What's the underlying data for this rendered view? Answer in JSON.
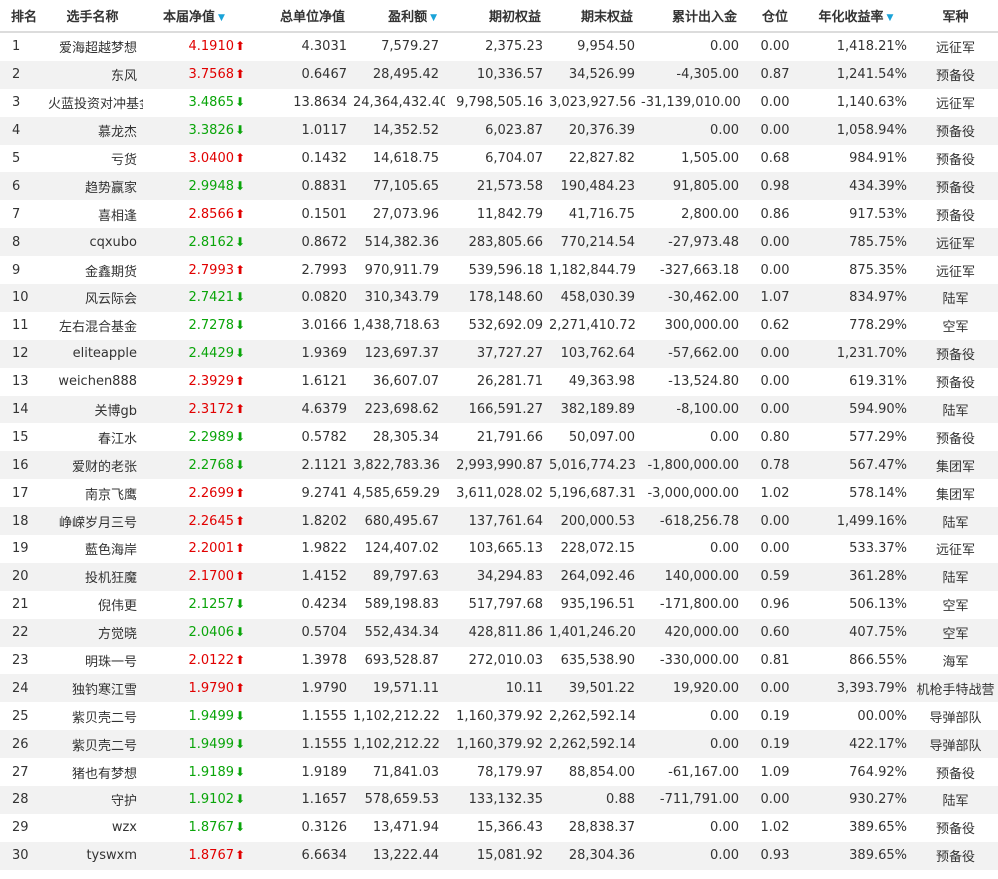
{
  "headers": {
    "rank": "排名",
    "name": "选手名称",
    "nav": "本届净值",
    "total_nav": "总单位净值",
    "profit": "盈利额",
    "start_equity": "期初权益",
    "end_equity": "期末权益",
    "cash_flow": "累计出入金",
    "position": "仓位",
    "annual": "年化收益率",
    "army": "军种"
  },
  "sort_icon": "▼",
  "colors": {
    "up": "#e10000",
    "down": "#0aa50a",
    "sort": "#1aa3d8",
    "stripe": "#f2f2f2"
  },
  "rows": [
    {
      "rank": "1",
      "name": "爱海超越梦想",
      "nav": "4.1910",
      "dir": "up",
      "total_nav": "4.3031",
      "profit": "7,579.27",
      "start": "2,375.23",
      "end": "9,954.50",
      "cash": "0.00",
      "pos": "0.00",
      "annual": "1,418.21%",
      "army": "远征军"
    },
    {
      "rank": "2",
      "name": "东风",
      "nav": "3.7568",
      "dir": "up",
      "total_nav": "0.6467",
      "profit": "28,495.42",
      "start": "10,336.57",
      "end": "34,526.99",
      "cash": "-4,305.00",
      "pos": "0.87",
      "annual": "1,241.54%",
      "army": "预备役"
    },
    {
      "rank": "3",
      "name": "火蓝投资对冲基金",
      "nav": "3.4865",
      "dir": "down",
      "total_nav": "13.8634",
      "profit": "24,364,432.40",
      "start": "9,798,505.16",
      "end": "3,023,927.56",
      "cash": "-31,139,010.00",
      "pos": "0.00",
      "annual": "1,140.63%",
      "army": "远征军"
    },
    {
      "rank": "4",
      "name": "慕龙杰",
      "nav": "3.3826",
      "dir": "down",
      "total_nav": "1.0117",
      "profit": "14,352.52",
      "start": "6,023.87",
      "end": "20,376.39",
      "cash": "0.00",
      "pos": "0.00",
      "annual": "1,058.94%",
      "army": "预备役"
    },
    {
      "rank": "5",
      "name": "亏货",
      "nav": "3.0400",
      "dir": "up",
      "total_nav": "0.1432",
      "profit": "14,618.75",
      "start": "6,704.07",
      "end": "22,827.82",
      "cash": "1,505.00",
      "pos": "0.68",
      "annual": "984.91%",
      "army": "预备役"
    },
    {
      "rank": "6",
      "name": "趋势赢家",
      "nav": "2.9948",
      "dir": "down",
      "total_nav": "0.8831",
      "profit": "77,105.65",
      "start": "21,573.58",
      "end": "190,484.23",
      "cash": "91,805.00",
      "pos": "0.98",
      "annual": "434.39%",
      "army": "预备役"
    },
    {
      "rank": "7",
      "name": "喜相逢",
      "nav": "2.8566",
      "dir": "up",
      "total_nav": "0.1501",
      "profit": "27,073.96",
      "start": "11,842.79",
      "end": "41,716.75",
      "cash": "2,800.00",
      "pos": "0.86",
      "annual": "917.53%",
      "army": "预备役"
    },
    {
      "rank": "8",
      "name": "cqxubo",
      "nav": "2.8162",
      "dir": "down",
      "total_nav": "0.8672",
      "profit": "514,382.36",
      "start": "283,805.66",
      "end": "770,214.54",
      "cash": "-27,973.48",
      "pos": "0.00",
      "annual": "785.75%",
      "army": "远征军"
    },
    {
      "rank": "9",
      "name": "金鑫期货",
      "nav": "2.7993",
      "dir": "up",
      "total_nav": "2.7993",
      "profit": "970,911.79",
      "start": "539,596.18",
      "end": "1,182,844.79",
      "cash": "-327,663.18",
      "pos": "0.00",
      "annual": "875.35%",
      "army": "远征军"
    },
    {
      "rank": "10",
      "name": "风云际会",
      "nav": "2.7421",
      "dir": "down",
      "total_nav": "0.0820",
      "profit": "310,343.79",
      "start": "178,148.60",
      "end": "458,030.39",
      "cash": "-30,462.00",
      "pos": "1.07",
      "annual": "834.97%",
      "army": "陆军"
    },
    {
      "rank": "11",
      "name": "左右混合基金",
      "nav": "2.7278",
      "dir": "down",
      "total_nav": "3.0166",
      "profit": "1,438,718.63",
      "start": "532,692.09",
      "end": "2,271,410.72",
      "cash": "300,000.00",
      "pos": "0.62",
      "annual": "778.29%",
      "army": "空军"
    },
    {
      "rank": "12",
      "name": "eliteapple",
      "nav": "2.4429",
      "dir": "down",
      "total_nav": "1.9369",
      "profit": "123,697.37",
      "start": "37,727.27",
      "end": "103,762.64",
      "cash": "-57,662.00",
      "pos": "0.00",
      "annual": "1,231.70%",
      "army": "预备役"
    },
    {
      "rank": "13",
      "name": "weichen888",
      "nav": "2.3929",
      "dir": "up",
      "total_nav": "1.6121",
      "profit": "36,607.07",
      "start": "26,281.71",
      "end": "49,363.98",
      "cash": "-13,524.80",
      "pos": "0.00",
      "annual": "619.31%",
      "army": "预备役"
    },
    {
      "rank": "14",
      "name": "关博gb",
      "nav": "2.3172",
      "dir": "up",
      "total_nav": "4.6379",
      "profit": "223,698.62",
      "start": "166,591.27",
      "end": "382,189.89",
      "cash": "-8,100.00",
      "pos": "0.00",
      "annual": "594.90%",
      "army": "陆军"
    },
    {
      "rank": "15",
      "name": "春江水",
      "nav": "2.2989",
      "dir": "down",
      "total_nav": "0.5782",
      "profit": "28,305.34",
      "start": "21,791.66",
      "end": "50,097.00",
      "cash": "0.00",
      "pos": "0.80",
      "annual": "577.29%",
      "army": "预备役"
    },
    {
      "rank": "16",
      "name": "爱财的老张",
      "nav": "2.2768",
      "dir": "down",
      "total_nav": "2.1121",
      "profit": "3,822,783.36",
      "start": "2,993,990.87",
      "end": "5,016,774.23",
      "cash": "-1,800,000.00",
      "pos": "0.78",
      "annual": "567.47%",
      "army": "集团军"
    },
    {
      "rank": "17",
      "name": "南京飞鹰",
      "nav": "2.2699",
      "dir": "up",
      "total_nav": "9.2741",
      "profit": "4,585,659.29",
      "start": "3,611,028.02",
      "end": "5,196,687.31",
      "cash": "-3,000,000.00",
      "pos": "1.02",
      "annual": "578.14%",
      "army": "集团军"
    },
    {
      "rank": "18",
      "name": "峥嵘岁月三号",
      "nav": "2.2645",
      "dir": "up",
      "total_nav": "1.8202",
      "profit": "680,495.67",
      "start": "137,761.64",
      "end": "200,000.53",
      "cash": "-618,256.78",
      "pos": "0.00",
      "annual": "1,499.16%",
      "army": "陆军"
    },
    {
      "rank": "19",
      "name": "藍色海岸",
      "nav": "2.2001",
      "dir": "up",
      "total_nav": "1.9822",
      "profit": "124,407.02",
      "start": "103,665.13",
      "end": "228,072.15",
      "cash": "0.00",
      "pos": "0.00",
      "annual": "533.37%",
      "army": "远征军"
    },
    {
      "rank": "20",
      "name": "投机狂魔",
      "nav": "2.1700",
      "dir": "up",
      "total_nav": "1.4152",
      "profit": "89,797.63",
      "start": "34,294.83",
      "end": "264,092.46",
      "cash": "140,000.00",
      "pos": "0.59",
      "annual": "361.28%",
      "army": "陆军"
    },
    {
      "rank": "21",
      "name": "倪伟更",
      "nav": "2.1257",
      "dir": "down",
      "total_nav": "0.4234",
      "profit": "589,198.83",
      "start": "517,797.68",
      "end": "935,196.51",
      "cash": "-171,800.00",
      "pos": "0.96",
      "annual": "506.13%",
      "army": "空军"
    },
    {
      "rank": "22",
      "name": "方觉晓",
      "nav": "2.0406",
      "dir": "down",
      "total_nav": "0.5704",
      "profit": "552,434.34",
      "start": "428,811.86",
      "end": "1,401,246.20",
      "cash": "420,000.00",
      "pos": "0.60",
      "annual": "407.75%",
      "army": "空军"
    },
    {
      "rank": "23",
      "name": "明珠一号",
      "nav": "2.0122",
      "dir": "up",
      "total_nav": "1.3978",
      "profit": "693,528.87",
      "start": "272,010.03",
      "end": "635,538.90",
      "cash": "-330,000.00",
      "pos": "0.81",
      "annual": "866.55%",
      "army": "海军"
    },
    {
      "rank": "24",
      "name": "独钓寒江雪",
      "nav": "1.9790",
      "dir": "up",
      "total_nav": "1.9790",
      "profit": "19,571.11",
      "start": "10.11",
      "end": "39,501.22",
      "cash": "19,920.00",
      "pos": "0.00",
      "annual": "3,393.79%",
      "army": "机枪手特战营"
    },
    {
      "rank": "25",
      "name": "紫贝壳二号",
      "nav": "1.9499",
      "dir": "down",
      "total_nav": "1.1555",
      "profit": "1,102,212.22",
      "start": "1,160,379.92",
      "end": "2,262,592.14",
      "cash": "0.00",
      "pos": "0.19",
      "annual": "00.00%",
      "army": "导弹部队"
    },
    {
      "rank": "26",
      "name": "紫贝壳二号",
      "nav": "1.9499",
      "dir": "down",
      "total_nav": "1.1555",
      "profit": "1,102,212.22",
      "start": "1,160,379.92",
      "end": "2,262,592.14",
      "cash": "0.00",
      "pos": "0.19",
      "annual": "422.17%",
      "army": "导弹部队"
    },
    {
      "rank": "27",
      "name": "猪也有梦想",
      "nav": "1.9189",
      "dir": "down",
      "total_nav": "1.9189",
      "profit": "71,841.03",
      "start": "78,179.97",
      "end": "88,854.00",
      "cash": "-61,167.00",
      "pos": "1.09",
      "annual": "764.92%",
      "army": "预备役"
    },
    {
      "rank": "28",
      "name": "守护",
      "nav": "1.9102",
      "dir": "down",
      "total_nav": "1.1657",
      "profit": "578,659.53",
      "start": "133,132.35",
      "end": "0.88",
      "cash": "-711,791.00",
      "pos": "0.00",
      "annual": "930.27%",
      "army": "陆军"
    },
    {
      "rank": "29",
      "name": "wzx",
      "nav": "1.8767",
      "dir": "down",
      "total_nav": "0.3126",
      "profit": "13,471.94",
      "start": "15,366.43",
      "end": "28,838.37",
      "cash": "0.00",
      "pos": "1.02",
      "annual": "389.65%",
      "army": "预备役"
    },
    {
      "rank": "30",
      "name": "tyswxm",
      "nav": "1.8767",
      "dir": "up",
      "total_nav": "6.6634",
      "profit": "13,222.44",
      "start": "15,081.92",
      "end": "28,304.36",
      "cash": "0.00",
      "pos": "0.93",
      "annual": "389.65%",
      "army": "预备役"
    }
  ]
}
